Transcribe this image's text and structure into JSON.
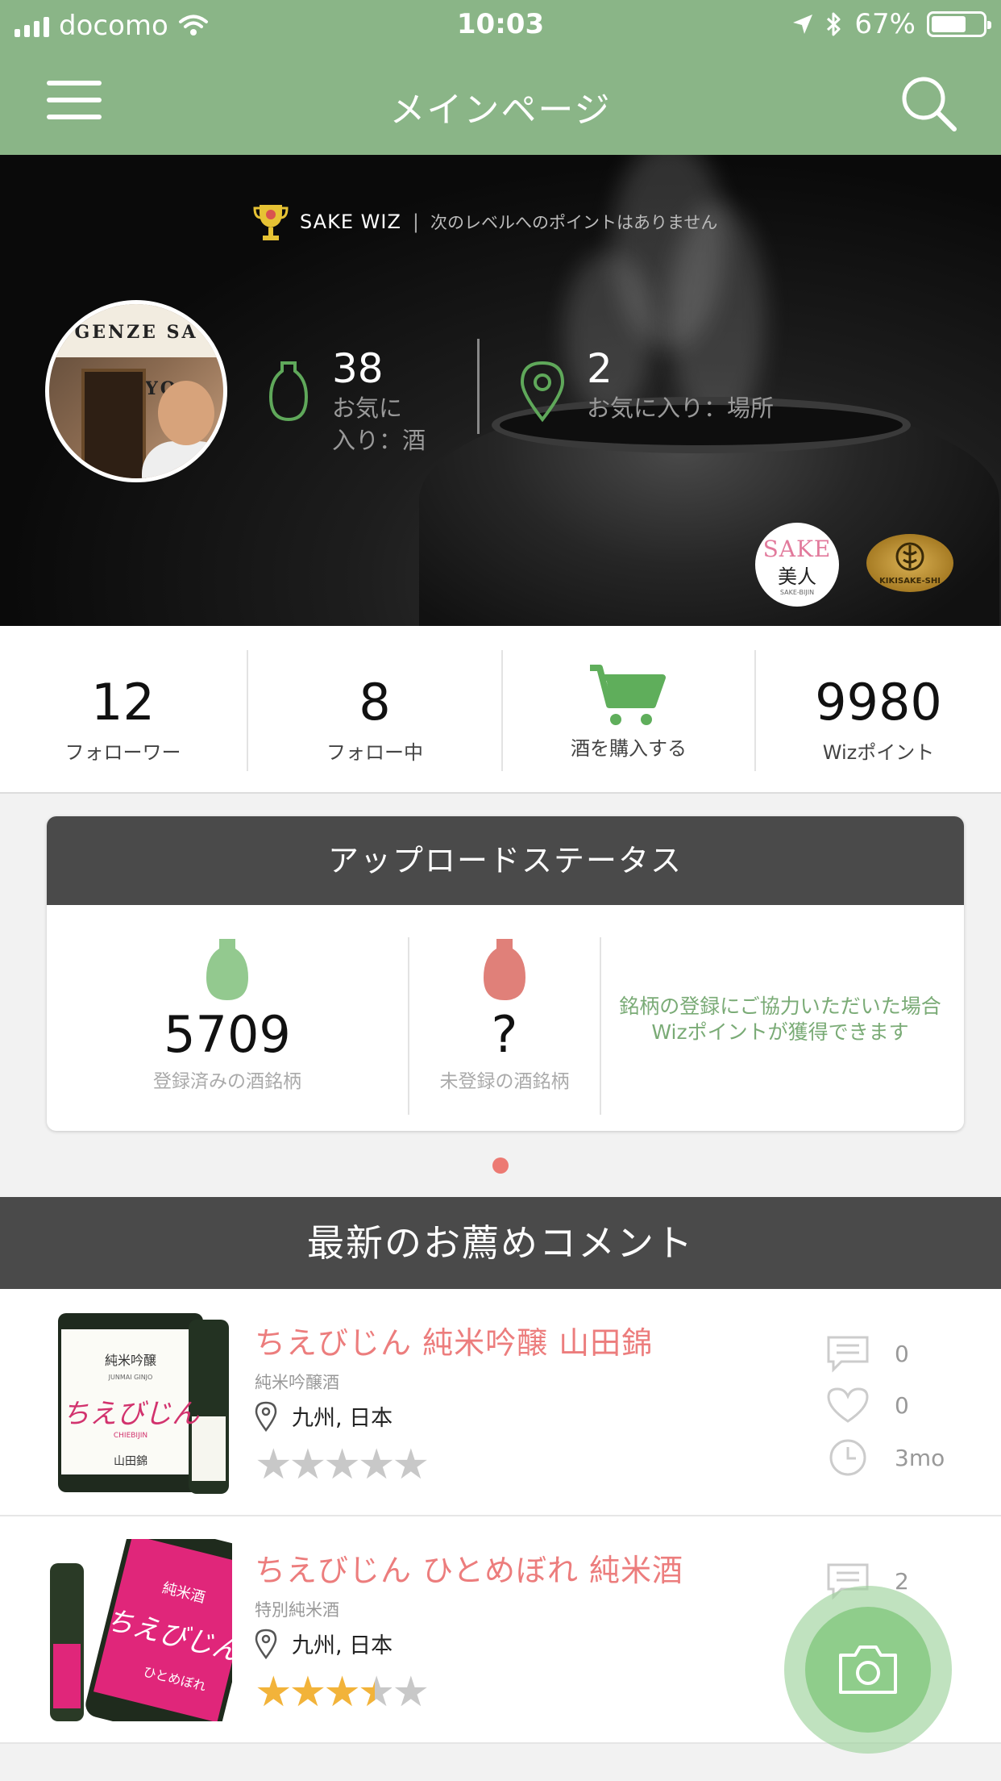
{
  "status_bar": {
    "carrier": "docomo",
    "time": "10:03",
    "battery": "67%"
  },
  "nav": {
    "title": "メインページ"
  },
  "hero": {
    "rank_name": "SAKE WIZ",
    "separator": "|",
    "rank_message": "次のレベルへのポイントはありません",
    "avatar_sign": "GENZE SA TOKYO",
    "favorites_sake_count": "38",
    "favorites_sake_label_1": "お気に",
    "favorites_sake_label_2": "入り：酒",
    "favorites_place_count": "2",
    "favorites_place_label": "お気に入り：場所",
    "badge_sake_top": "SAKE",
    "badge_sake_mid": "美人",
    "badge_sake_bottom": "SAKE-BIJIN",
    "badge_kiki": "KIKISAKE-SHI"
  },
  "stats": {
    "followers": {
      "value": "12",
      "label": "フォローワー"
    },
    "following": {
      "value": "8",
      "label": "フォロー中"
    },
    "buy": {
      "label": "酒を購入する"
    },
    "wiz_points": {
      "value": "9980",
      "label": "Wizポイント"
    }
  },
  "upload_status": {
    "title": "アップロードステータス",
    "registered": {
      "value": "5709",
      "label": "登録済みの酒銘柄"
    },
    "unregistered": {
      "value": "?",
      "label": "未登録の酒銘柄"
    },
    "note_line1": "銘柄の登録にご協力いただいた場合",
    "note_line2": "Wizポイントが獲得できます"
  },
  "comments": {
    "title": "最新のお薦めコメント",
    "items": [
      {
        "name": "ちえびじん 純米吟醸 山田錦",
        "type": "純米吟醸酒",
        "location": "九州, 日本",
        "rating": 0,
        "comments": "0",
        "likes": "0",
        "age": "3mo",
        "label_text": "ちえびじん",
        "label_sub": "純米吟醸",
        "label_sub2": "JUNMAI GINJO",
        "label_brand": "CHIEBIJIN",
        "label_rice": "山田錦"
      },
      {
        "name": "ちえびじん ひとめぼれ 純米酒",
        "type": "特別純米酒",
        "location": "九州, 日本",
        "rating": 3.5,
        "comments": "2",
        "label_text": "ちえびじん",
        "label_sub": "純米酒",
        "label_rice": "ひとめぼれ"
      }
    ]
  },
  "colors": {
    "header_green": "#8ab587",
    "accent_pink": "#ec7d7d",
    "registered_green": "#93c98f",
    "unregistered_red": "#e08079",
    "cart_green": "#5fae5b",
    "star_gold": "#f2b33a"
  }
}
